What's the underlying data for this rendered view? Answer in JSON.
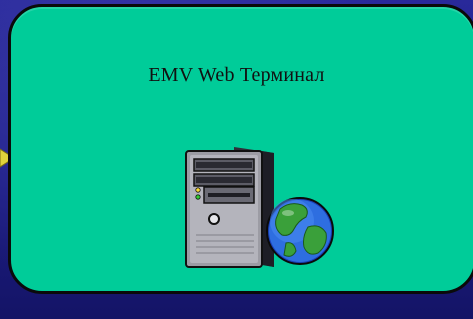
{
  "title": "EMV Web Терминал",
  "colors": {
    "background": "#21218f",
    "card_fill": "#00cc99",
    "card_border": "#0a0a0a",
    "arrow": "#e0d23c",
    "title_text": "#111111"
  },
  "icons": {
    "server": "server-tower-icon",
    "globe": "globe-icon",
    "arrow": "arrow-tip-icon"
  }
}
